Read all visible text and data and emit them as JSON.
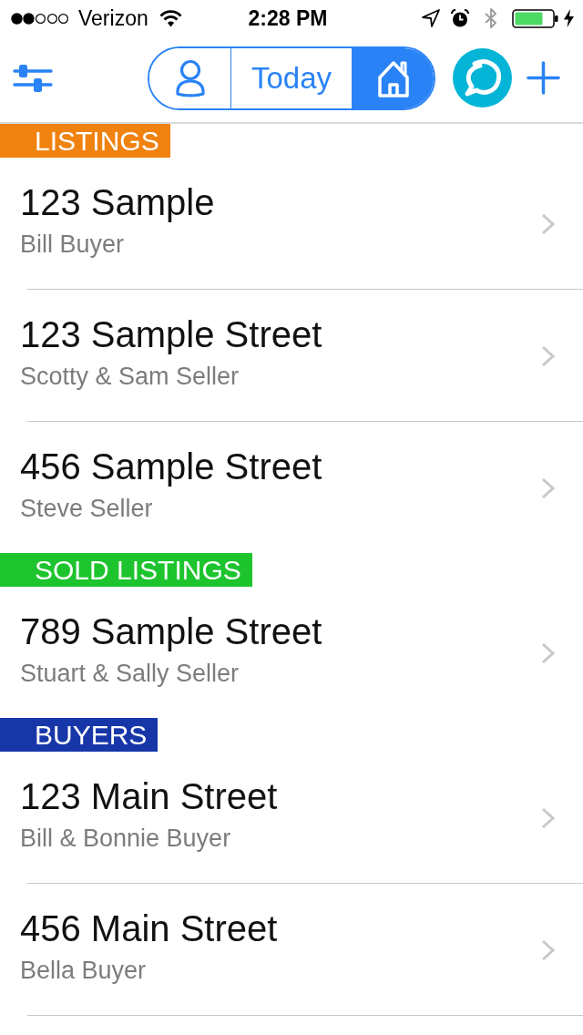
{
  "status_bar": {
    "carrier": "Verizon",
    "time": "2:28 PM"
  },
  "nav": {
    "segments": [
      {
        "kind": "person",
        "selected": false
      },
      {
        "kind": "text",
        "label": "Today",
        "selected": false
      },
      {
        "kind": "home",
        "selected": true
      }
    ]
  },
  "sections": [
    {
      "title": "LISTINGS",
      "color": "#f0820f",
      "rows": [
        {
          "title": "123 Sample",
          "subtitle": "Bill Buyer"
        },
        {
          "title": "123 Sample Street",
          "subtitle": "Scotty & Sam Seller"
        },
        {
          "title": "456 Sample Street",
          "subtitle": "Steve Seller"
        }
      ]
    },
    {
      "title": "SOLD LISTINGS",
      "color": "#1ec42e",
      "rows": [
        {
          "title": "789 Sample Street",
          "subtitle": "Stuart & Sally Seller"
        }
      ]
    },
    {
      "title": "BUYERS",
      "color": "#1737a9",
      "rows": [
        {
          "title": "123 Main Street",
          "subtitle": "Bill & Bonnie Buyer"
        },
        {
          "title": "456 Main Street",
          "subtitle": "Bella Buyer"
        }
      ]
    }
  ]
}
